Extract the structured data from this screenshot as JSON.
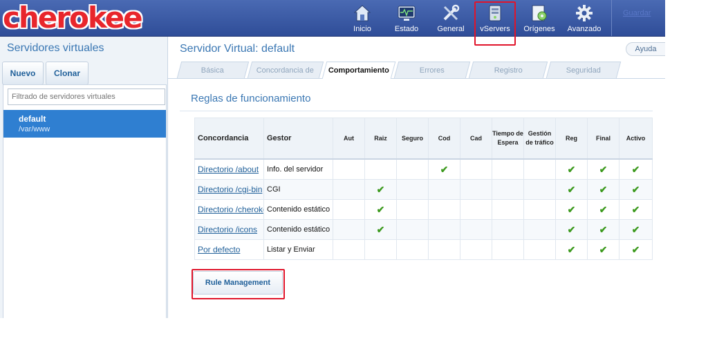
{
  "header": {
    "logo": "cherokee",
    "nav": [
      {
        "label": "Inicio",
        "icon": "home-icon"
      },
      {
        "label": "Estado",
        "icon": "monitor-icon"
      },
      {
        "label": "General",
        "icon": "tools-icon"
      },
      {
        "label": "vServers",
        "icon": "server-icon"
      },
      {
        "label": "Orígenes",
        "icon": "gear-doc-icon"
      },
      {
        "label": "Avanzado",
        "icon": "gear-icon"
      }
    ],
    "save": "Guardar"
  },
  "sidebar": {
    "title": "Servidores virtuales",
    "new_button": "Nuevo",
    "clone_button": "Clonar",
    "filter_placeholder": "Filtrado de servidores virtuales",
    "servers": [
      {
        "name": "default",
        "path": "/var/www"
      }
    ]
  },
  "main": {
    "title": "Servidor Virtual: default",
    "help": "Ayuda",
    "tabs": [
      "Básica",
      "Concordancia de",
      "Comportamiento",
      "Errores",
      "Registro",
      "Seguridad"
    ],
    "active_tab": "Comportamiento",
    "section_title": "Reglas de funcionamiento",
    "table": {
      "headers": {
        "match": "Concordancia",
        "handler": "Gestor",
        "aut": "Aut",
        "raiz": "Raiz",
        "seguro": "Seguro",
        "cod": "Cod",
        "cad": "Cad",
        "tiempo": "Tiempo de Espera",
        "gestion": "Gestión de tráfico",
        "reg": "Reg",
        "final": "Final",
        "activo": "Activo"
      },
      "rows": [
        {
          "match": "Directorio /about",
          "handler": "Info. del servidor"
        },
        {
          "match": "Directorio /cgi-bin",
          "handler": "CGI"
        },
        {
          "match": "Directorio /cherokee_themes",
          "handler": "Contenido estático"
        },
        {
          "match": "Directorio /icons",
          "handler": "Contenido estático"
        },
        {
          "match": "Por defecto",
          "handler": "Listar y Enviar"
        }
      ],
      "checks": [
        [
          false,
          false,
          false,
          true,
          false,
          false,
          false,
          true,
          true,
          true
        ],
        [
          false,
          true,
          false,
          false,
          false,
          false,
          false,
          true,
          true,
          true
        ],
        [
          false,
          true,
          false,
          false,
          false,
          false,
          false,
          true,
          true,
          true
        ],
        [
          false,
          true,
          false,
          false,
          false,
          false,
          false,
          true,
          true,
          true
        ],
        [
          false,
          false,
          false,
          false,
          false,
          false,
          false,
          true,
          true,
          true
        ]
      ],
      "check_glyph": "✔"
    },
    "rule_management_button": "Rule Management"
  }
}
